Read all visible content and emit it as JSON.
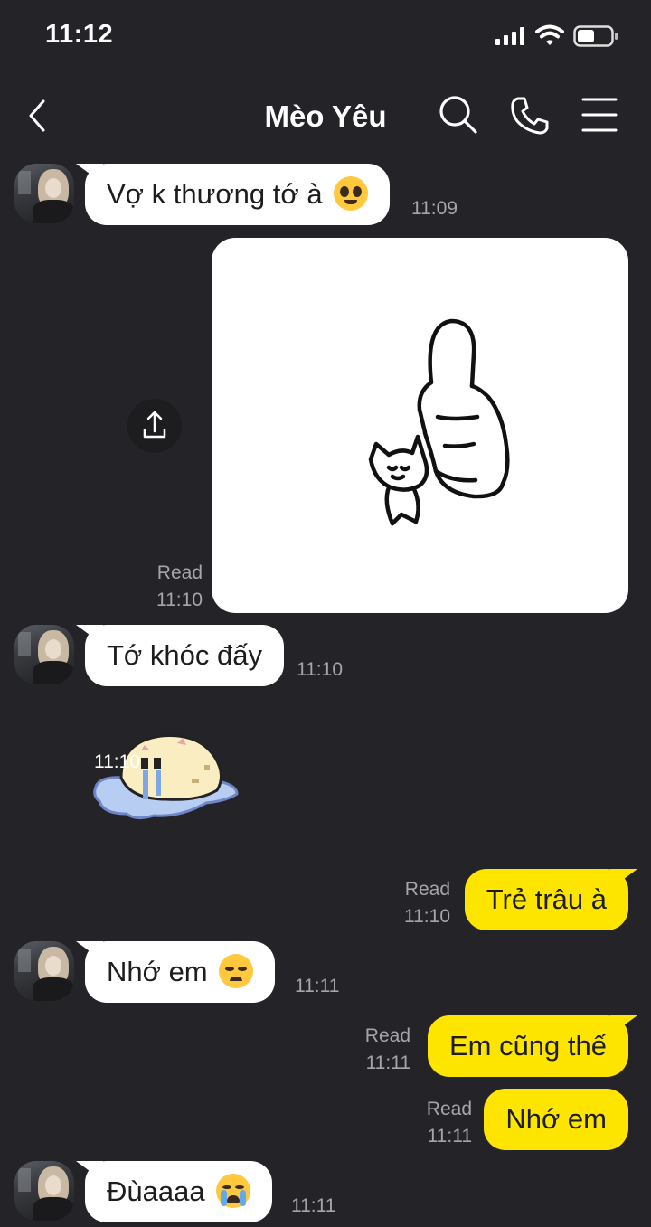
{
  "status_bar": {
    "time": "11:12"
  },
  "header": {
    "title": "Mèo Yêu"
  },
  "messages": [
    {
      "text": "Vợ k thương tớ à",
      "time": "11:09"
    },
    {
      "read": "Read",
      "time": "11:10"
    },
    {
      "text": "Tớ khóc đấy",
      "time": "11:10"
    },
    {
      "time": "11:10"
    },
    {
      "text": "Trẻ trâu à",
      "read": "Read",
      "time": "11:10"
    },
    {
      "text": "Nhớ em",
      "time": "11:11"
    },
    {
      "text": "Em cũng thế",
      "read": "Read",
      "time": "11:11"
    },
    {
      "text": "Nhớ em",
      "read": "Read",
      "time": "11:11"
    },
    {
      "text": "Đùaaaa",
      "time": "11:11"
    }
  ],
  "colors": {
    "background": "#242428",
    "incoming_bubble": "#ffffff",
    "outgoing_bubble": "#fee500",
    "meta_text": "#a6a6aa"
  },
  "icons": [
    "back-icon",
    "search-icon",
    "phone-icon",
    "menu-icon",
    "share-icon",
    "pleading-face-emoji",
    "disappointed-face-emoji",
    "loudly-crying-face-emoji"
  ]
}
